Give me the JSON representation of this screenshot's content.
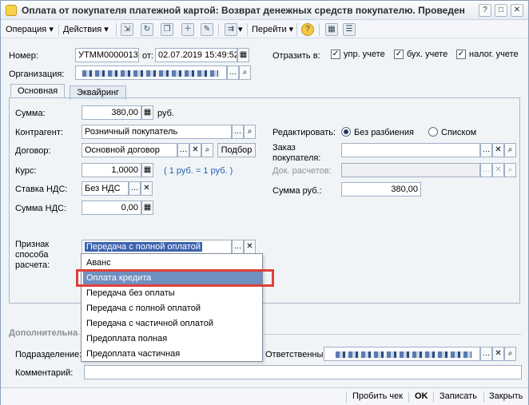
{
  "title": "Оплата от покупателя платежной картой: Возврат денежных средств покупателю. Проведен",
  "toolbar": {
    "operation": "Операция",
    "actions": "Действия",
    "goto": "Перейти"
  },
  "header": {
    "number_label": "Номер:",
    "number_value": "УТММ0000013",
    "from_label": "от:",
    "date_value": "02.07.2019 15:49:52",
    "reflect_label": "Отразить в:",
    "chk_upr": "упр. учете",
    "chk_buh": "бух. учете",
    "chk_nalog": "налог. учете",
    "org_label": "Организация:"
  },
  "tabs": [
    "Основная",
    "Эквайринг"
  ],
  "main": {
    "sum_label": "Сумма:",
    "sum_value": "380,00",
    "currency": "руб.",
    "kontragent_label": "Контрагент:",
    "kontragent_value": "Розничный покупатель",
    "dogovor_label": "Договор:",
    "dogovor_value": "Основной договор",
    "podbor": "Подбор",
    "kurs_label": "Курс:",
    "kurs_value": "1,0000",
    "kurs_note": "( 1 руб. = 1 руб. )",
    "nds_rate_label": "Ставка НДС:",
    "nds_rate_value": "Без НДС",
    "nds_sum_label": "Сумма НДС:",
    "nds_sum_value": "0,00",
    "edit_label": "Редактировать:",
    "radio_nosplit": "Без разбиения",
    "radio_list": "Списком",
    "order_label_1": "Заказ",
    "order_label_2": "покупателя:",
    "doc_label": "Док. расчетов:",
    "sum_rub_label": "Сумма руб.:",
    "sum_rub_value": "380,00",
    "payment_label_1": "Признак",
    "payment_label_2": "способа",
    "payment_label_3": "расчета:",
    "payment_value": "Передача с полной оплатой"
  },
  "dropdown": {
    "items": [
      "Аванс",
      "Оплата кредита",
      "Передача без оплаты",
      "Передача с полной оплатой",
      "Передача с частичной оплатой",
      "Предоплата полная",
      "Предоплата частичная"
    ],
    "highlighted": "Оплата кредита"
  },
  "additional": {
    "section": "Дополнительна",
    "dept_label": "Подразделение:",
    "responsible_label": "Ответственны",
    "comment_label": "Комментарий:"
  },
  "statusbar": {
    "print_check": "Пробить чек",
    "ok": "OK",
    "save": "Записать",
    "close": "Закрыть"
  }
}
